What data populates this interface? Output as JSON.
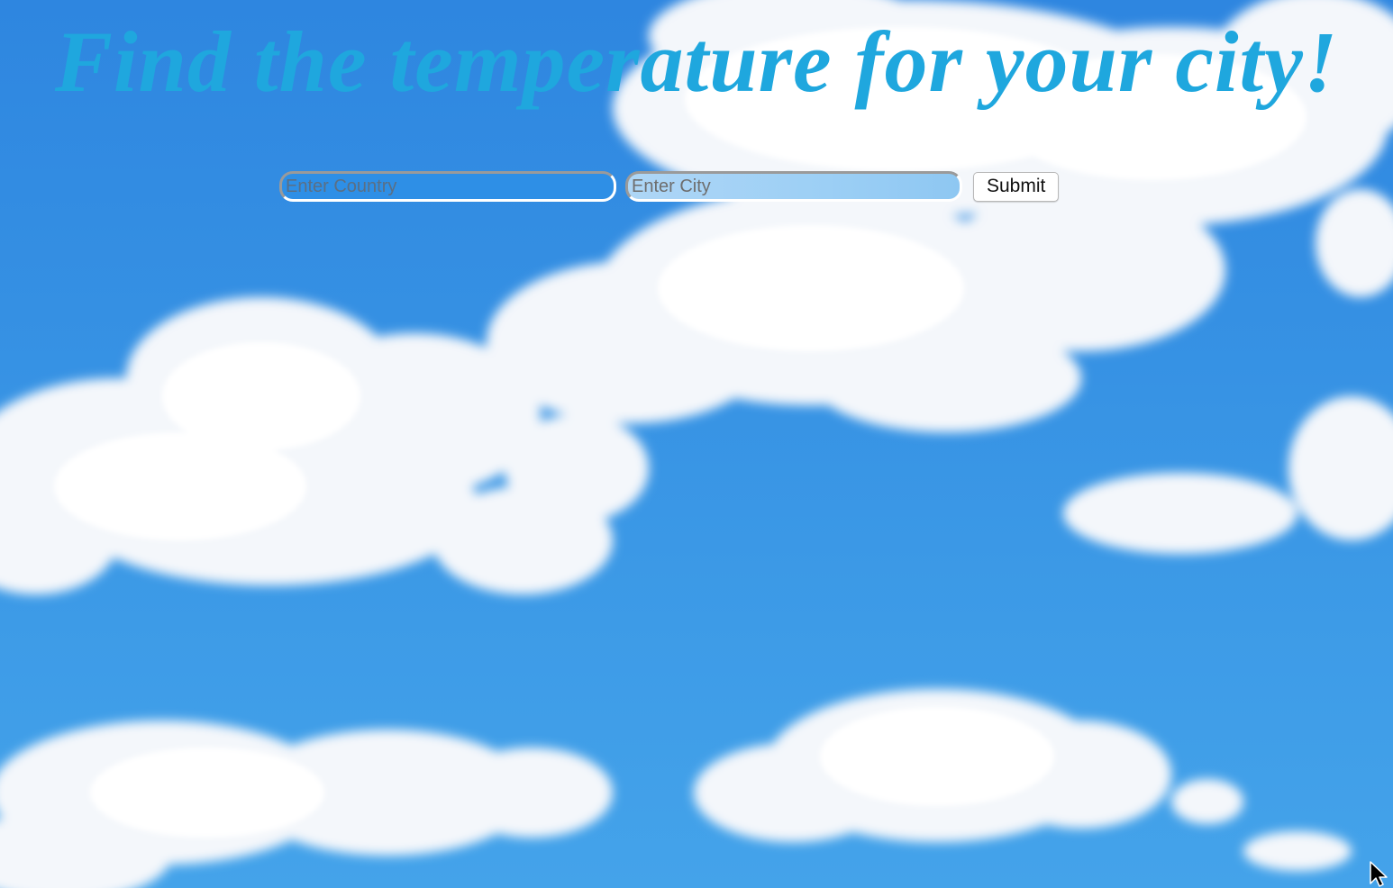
{
  "page": {
    "title": "Find the temperature for your city!"
  },
  "form": {
    "country_placeholder": "Enter Country",
    "city_placeholder": "Enter City",
    "submit_label": "Submit"
  },
  "colors": {
    "title": "#1fa7de",
    "sky": "#3590e3"
  },
  "background": {
    "icon": "sky-with-clouds-image"
  }
}
